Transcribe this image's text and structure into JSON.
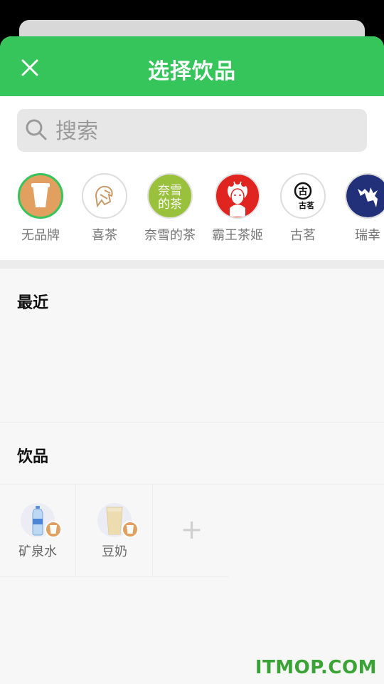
{
  "header": {
    "title": "选择饮品"
  },
  "search": {
    "placeholder": "搜索"
  },
  "brands": [
    {
      "label": "无品牌",
      "icon": "cup-icon",
      "selected": true
    },
    {
      "label": "喜茶",
      "icon": "heytea-logo"
    },
    {
      "label": "奈雪的茶",
      "icon": "nayuki-logo",
      "logo_text": "奈雪的茶"
    },
    {
      "label": "霸王茶姬",
      "icon": "chagee-logo"
    },
    {
      "label": "古茗",
      "icon": "goodme-logo",
      "logo_text": "古茗"
    },
    {
      "label": "瑞幸",
      "icon": "luckin-logo"
    }
  ],
  "sections": {
    "recent": "最近",
    "drinks": "饮品"
  },
  "drinks": [
    {
      "name": "矿泉水",
      "icon": "water-bottle-icon"
    },
    {
      "name": "豆奶",
      "icon": "soy-milk-glass-icon"
    }
  ],
  "add_label": "+",
  "watermark": "ITMOP.COM",
  "colors": {
    "accent": "#35c55a",
    "brand_badge": "#e1a060"
  }
}
